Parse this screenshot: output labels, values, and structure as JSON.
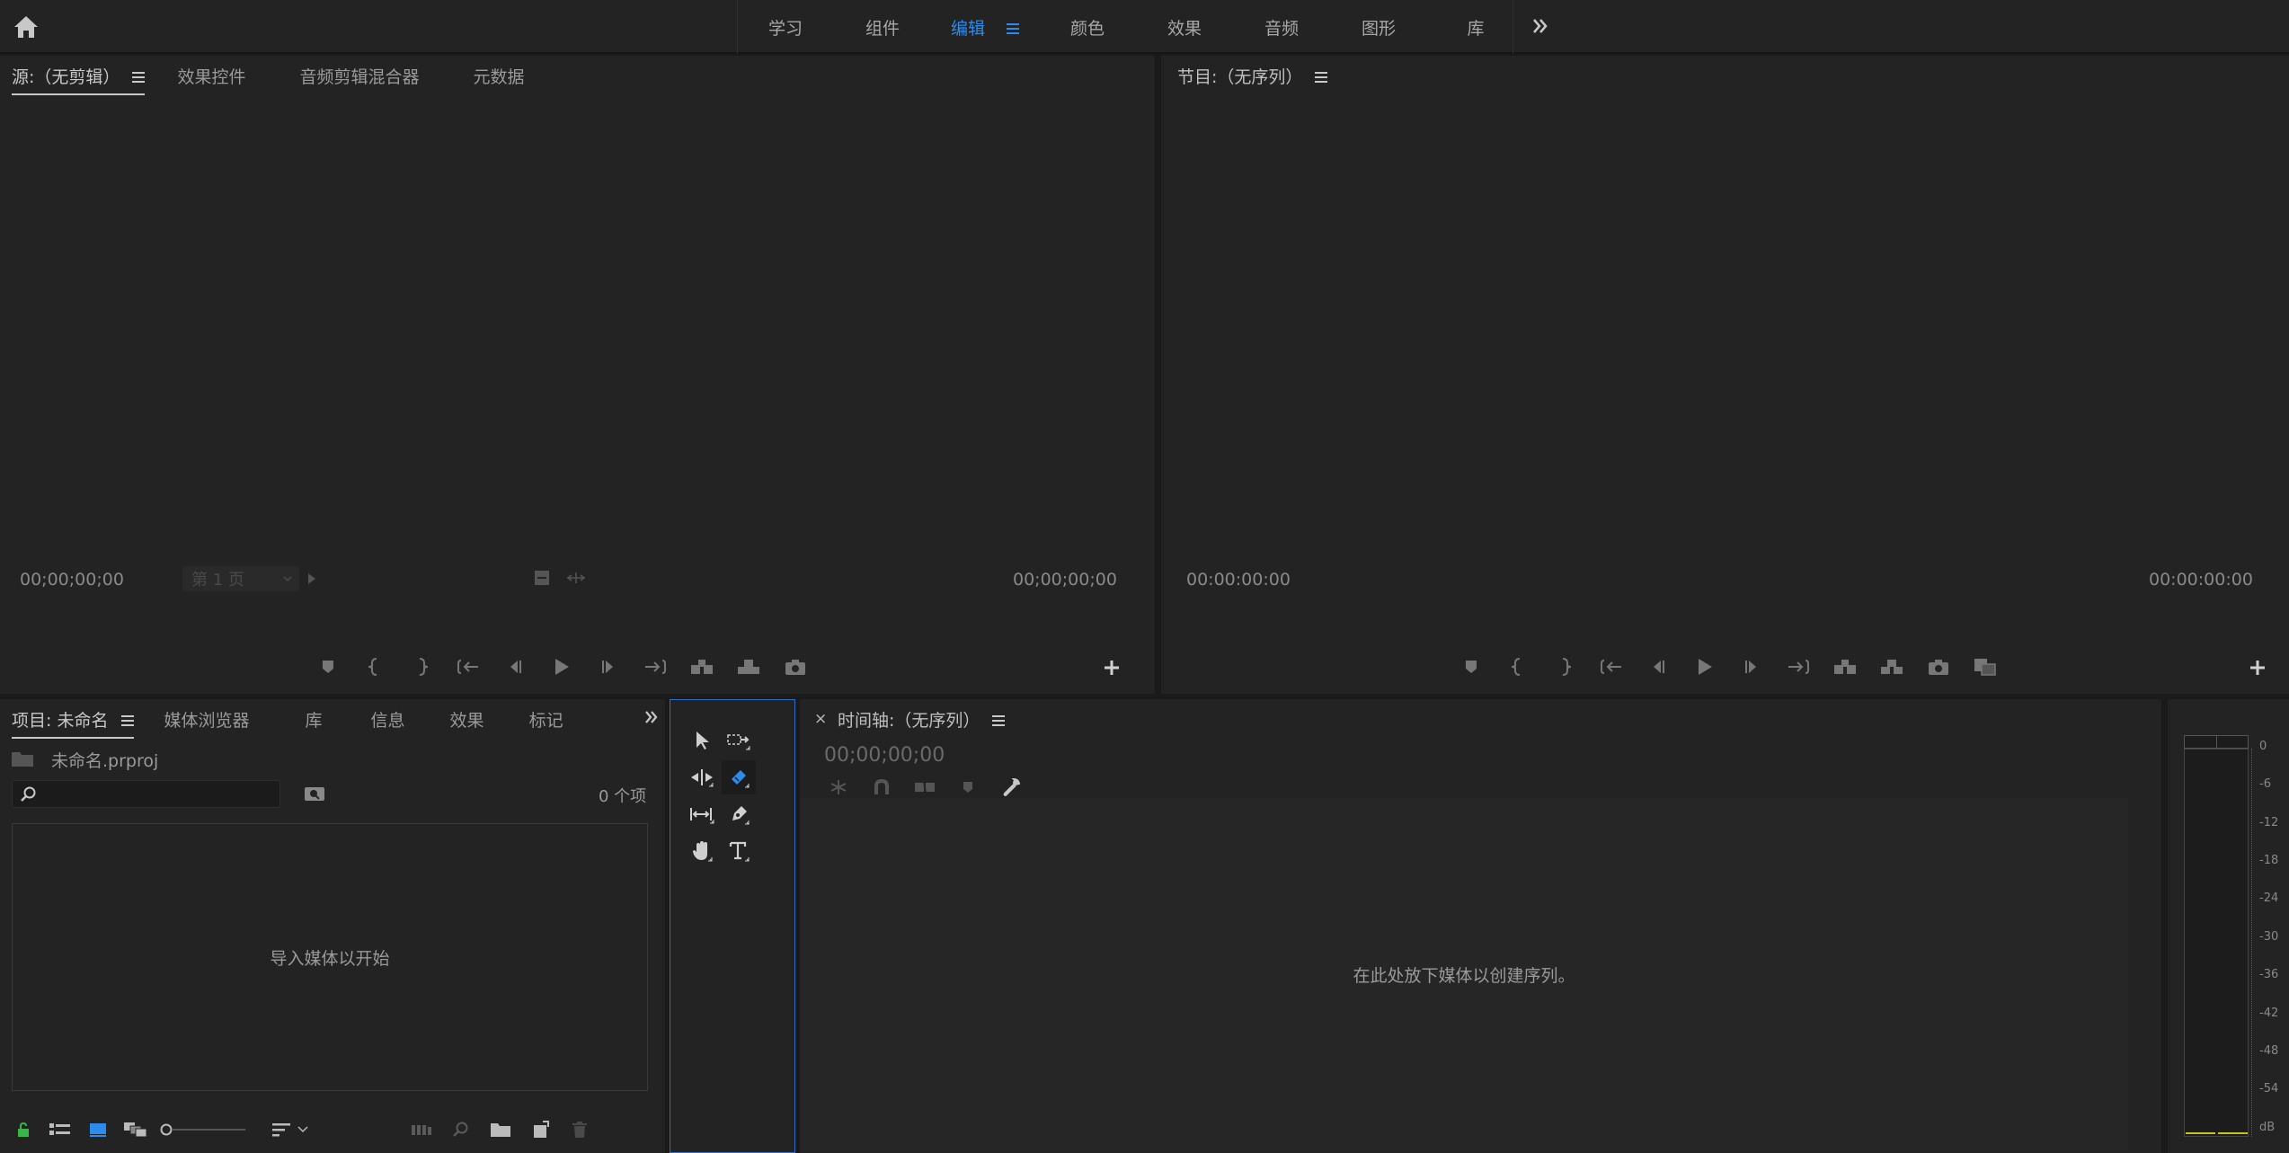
{
  "topbar": {
    "tabs": [
      {
        "label": "学习",
        "active": false
      },
      {
        "label": "组件",
        "active": false
      },
      {
        "label": "编辑",
        "active": true
      },
      {
        "label": "颜色",
        "active": false
      },
      {
        "label": "效果",
        "active": false
      },
      {
        "label": "音频",
        "active": false
      },
      {
        "label": "图形",
        "active": false
      },
      {
        "label": "库",
        "active": false
      }
    ],
    "icons": {
      "home": "home-icon",
      "more": "double-chevron-right-icon"
    },
    "accent_color": "#2d8ceb"
  },
  "source_panel": {
    "tabs": [
      "源:（无剪辑）",
      "效果控件",
      "音频剪辑混合器",
      "元数据"
    ],
    "timecode_in": "00;00;00;00",
    "timecode_out": "00;00;00;00",
    "page_select": "第 1 页"
  },
  "program_panel": {
    "tab": "节目:（无序列）",
    "timecode_in": "00:00:00:00",
    "timecode_out": "00:00:00:00"
  },
  "project_panel": {
    "tabs": [
      "项目: 未命名",
      "媒体浏览器",
      "库",
      "信息",
      "效果",
      "标记"
    ],
    "file_name": "未命名.prproj",
    "search_placeholder": "",
    "item_count": "0 个项",
    "empty_message": "导入媒体以开始"
  },
  "timeline_panel": {
    "close": "×",
    "tab": "时间轴:（无序列）",
    "timecode": "00;00;00;00",
    "empty_message": "在此处放下媒体以创建序列。"
  },
  "audio_meter": {
    "labels": [
      "0",
      "-6",
      "-12",
      "-18",
      "-24",
      "-30",
      "-36",
      "-42",
      "-48",
      "-54",
      "dB"
    ]
  }
}
